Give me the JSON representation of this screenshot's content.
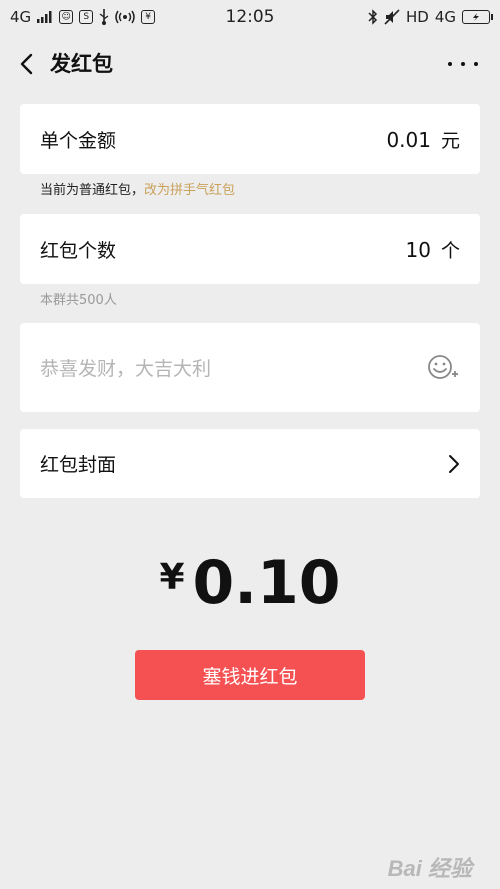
{
  "status_bar": {
    "network_left": "4G",
    "time": "12:05",
    "hd": "HD",
    "network_right": "4G"
  },
  "header": {
    "title": "发红包",
    "back_icon": "chevron-left-icon",
    "more_icon": "more-dots-icon"
  },
  "amount_card": {
    "label": "单个金额",
    "value": "0.01",
    "unit": "元"
  },
  "hint_type": {
    "text": "当前为普通红包，",
    "link": "改为拼手气红包"
  },
  "count_card": {
    "label": "红包个数",
    "value": "10",
    "unit": "个"
  },
  "hint_group": {
    "text": "本群共500人"
  },
  "message": {
    "placeholder": "恭喜发财，大吉大利",
    "emoji_icon": "emoji-add-icon"
  },
  "cover_card": {
    "label": "红包封面",
    "chevron_icon": "chevron-right-icon"
  },
  "total": {
    "currency": "¥",
    "amount": "0.10"
  },
  "send_button": {
    "label": "塞钱进红包"
  },
  "colors": {
    "background": "#ededed",
    "accent_red": "#f55152",
    "link_gold": "#c9a15a"
  },
  "watermark": {
    "text": "Bai 经验"
  }
}
